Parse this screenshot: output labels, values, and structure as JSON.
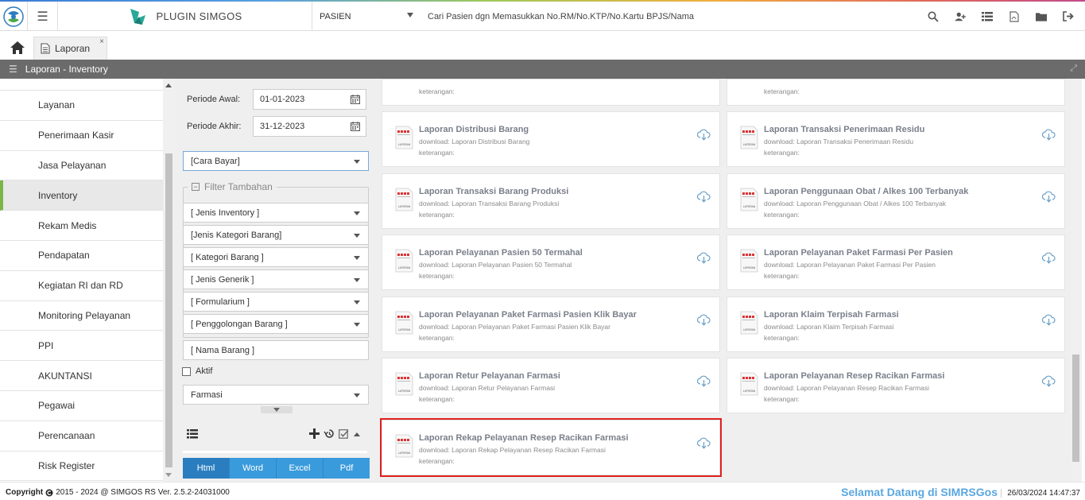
{
  "app": {
    "brand": "PLUGIN SIMGOS",
    "patient_select": "PASIEN",
    "search_placeholder": "Cari Pasien dgn Memasukkan No.RM/No.KTP/No.Kartu BPJS/Nama"
  },
  "tabs": [
    {
      "label": "Laporan",
      "close": "×"
    }
  ],
  "panel_title": "Laporan - Inventory",
  "sidebar": {
    "items": [
      {
        "label": "Layanan"
      },
      {
        "label": "Penerimaan Kasir"
      },
      {
        "label": "Jasa Pelayanan"
      },
      {
        "label": "Inventory",
        "active": true
      },
      {
        "label": "Rekam Medis"
      },
      {
        "label": "Pendapatan"
      },
      {
        "label": "Kegiatan RI dan RD"
      },
      {
        "label": "Monitoring Pelayanan"
      },
      {
        "label": "PPI"
      },
      {
        "label": "AKUNTANSI"
      },
      {
        "label": "Pegawai"
      },
      {
        "label": "Perencanaan"
      },
      {
        "label": "Risk Register"
      }
    ]
  },
  "filter": {
    "periode_awal_label": "Periode Awal:",
    "periode_awal_value": "01-01-2023",
    "periode_akhir_label": "Periode Akhir:",
    "periode_akhir_value": "31-12-2023",
    "cara_bayar": "[Cara Bayar]",
    "filter_tambahan": "Filter Tambahan",
    "selects": [
      "[ Jenis Inventory ]",
      "[Jenis Kategori Barang]",
      "[ Kategori Barang ]",
      "[ Jenis Generik ]",
      "[ Formularium ]",
      "[ Penggolongan Barang ]"
    ],
    "nama_barang_placeholder": "[ Nama Barang ]",
    "aktif_label": "Aktif",
    "depo": "Farmasi",
    "format_buttons": [
      "Html",
      "Word",
      "Excel",
      "Pdf"
    ],
    "active_format": "Html"
  },
  "reports": {
    "download_prefix": "download: ",
    "keterangan_label": "keterangan:",
    "items": [
      {
        "title": "Laporan Distribusi Barang",
        "download": "Laporan Distribusi Barang"
      },
      {
        "title": "Laporan Transaksi Penerimaan Residu",
        "download": "Laporan Transaksi Penerimaan Residu"
      },
      {
        "title": "Laporan Transaksi Barang Produksi",
        "download": "Laporan Transaksi Barang Produksi"
      },
      {
        "title": "Laporan Penggunaan Obat / Alkes 100 Terbanyak",
        "download": "Laporan Penggunaan Obat / Alkes 100 Terbanyak"
      },
      {
        "title": "Laporan Pelayanan Pasien 50 Termahal",
        "download": "Laporan Pelayanan Pasien 50 Termahal"
      },
      {
        "title": "Laporan Pelayanan Paket Farmasi Per Pasien",
        "download": "Laporan Pelayanan Paket Farmasi Per Pasien"
      },
      {
        "title": "Laporan Pelayanan Paket Farmasi Pasien Klik Bayar",
        "download": "Laporan Pelayanan Paket Farmasi Pasien Klik Bayar"
      },
      {
        "title": "Laporan Klaim Terpisah Farmasi",
        "download": "Laporan Klaim Terpisah Farmasi"
      },
      {
        "title": "Laporan Retur Pelayanan Farmasi",
        "download": "Laporan Retur Pelayanan Farmasi"
      },
      {
        "title": "Laporan Pelayanan Resep Racikan Farmasi",
        "download": "Laporan Pelayanan Resep Racikan Farmasi"
      },
      {
        "title": "Laporan Rekap Pelayanan Resep Racikan Farmasi",
        "download": "Laporan Rekap Pelayanan Resep Racikan Farmasi",
        "selected": true
      }
    ],
    "icon_caption": "LAPORAN"
  },
  "footer": {
    "copyright_label": "Copyright",
    "copyright_text": "2015 - 2024 @ SIMGOS RS Ver. 2.5.2-24031000",
    "welcome": "Selamat Datang di SIMRSGos",
    "datetime": "26/03/2024 14:47:37"
  },
  "colors": {
    "accent": "#3a9bdc",
    "active_sidebar": "#7ab648",
    "selected_outline": "#e02020",
    "welcome": "#5aa7e0"
  }
}
